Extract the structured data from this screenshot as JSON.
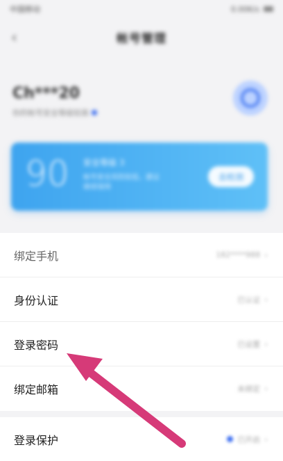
{
  "status_bar": {
    "carrier": "中国移动",
    "right_text": "0.00K/s"
  },
  "header": {
    "back_icon": "chevron-left-icon",
    "title": "帐号管理"
  },
  "profile": {
    "username": "Ch***20",
    "subline": "你的帐号安全等级较高",
    "avatar_icon": "user-avatar-icon"
  },
  "score_card": {
    "score": "90",
    "level": "安全等级 3",
    "desc_line1": "帐号安全风险较低，建议",
    "desc_line2": "继续保持",
    "button_label": "去检测"
  },
  "settings": {
    "rows": [
      {
        "label": "绑定手机",
        "value": "182****988"
      },
      {
        "label": "身份认证",
        "value": "已认证"
      },
      {
        "label": "登录密码",
        "value": "已设置"
      },
      {
        "label": "绑定邮箱",
        "value": "未绑定"
      }
    ],
    "login_protect": {
      "label": "登录保护",
      "value": "已开启"
    }
  },
  "colors": {
    "accent": "#3a6cf0",
    "card_start": "#3ea4ef",
    "card_end": "#5fc0f7",
    "arrow": "#d63a78"
  }
}
